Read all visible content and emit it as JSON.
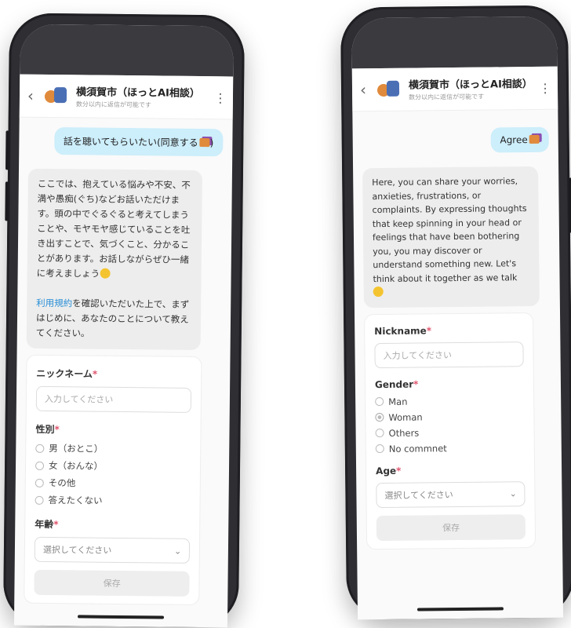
{
  "left": {
    "header": {
      "title": "横須賀市（ほっとAI相談）",
      "subtitle": "数分以内に返信が可能です"
    },
    "user_message": "話を聴いてもらいたい(同意する",
    "bot_message_1": "ここでは、抱えている悩みや不安、不満や愚痴(ぐち)などお話いただけます。頭の中でぐるぐると考えてしまうことや、モヤモヤ感じていることを吐き出すことで、気づくこと、分かることがあります。お話しながらぜひ一緒に考えましょう",
    "bot_link": "利用規約",
    "bot_message_2": "を確認いただいた上で、まずはじめに、あなたのことについて教えてください。",
    "form": {
      "nickname_label": "ニックネーム",
      "nickname_placeholder": "入力してください",
      "gender_label": "性別",
      "gender_options": [
        "男（おとこ）",
        "女（おんな）",
        "その他",
        "答えたくない"
      ],
      "age_label": "年齢",
      "age_placeholder": "選択してください",
      "save_label": "保存"
    }
  },
  "right": {
    "header": {
      "title": "横須賀市（ほっとAI相談）",
      "subtitle": "数分以内に返信が可能です"
    },
    "user_message": "Agree",
    "bot_message": "Here, you can share your worries, anxieties, frustrations, or complaints. By expressing thoughts that keep spinning in your head or feelings that have been bothering you, you may discover or understand something new. Let's think about it together as we talk",
    "form": {
      "nickname_label": "Nickname",
      "nickname_placeholder": "入力してください",
      "gender_label": "Gender",
      "gender_options": [
        "Man",
        "Woman",
        "Others",
        "No commnet"
      ],
      "gender_selected": "Woman",
      "age_label": "Age",
      "age_placeholder": "選択してください",
      "save_label": "保存"
    }
  },
  "icons": {
    "back": "chevron-left-icon",
    "menu": "more-vertical-icon",
    "select": "chevron-down-icon"
  },
  "colors": {
    "user_bubble": "#cdeefb",
    "bot_bubble": "#ededed",
    "link": "#2a8fd6",
    "required": "#e0506b",
    "phone_frame": "#2e2e33"
  }
}
